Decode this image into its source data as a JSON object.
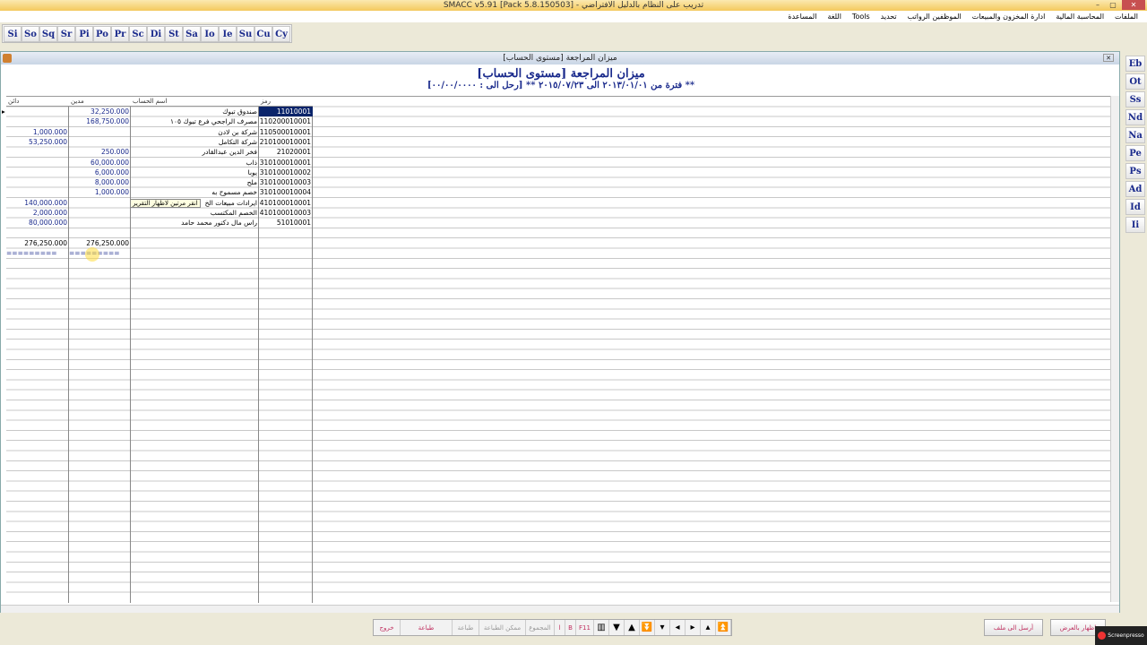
{
  "app": {
    "title": "SMACC v5.91 [Pack 5.8.150503]  -  تدريب على النظام بالدليل الافتراضي"
  },
  "menu": [
    "الملفات",
    "المحاسبة المالية",
    "ادارة المخزون والمبيعات",
    "الموظفين الرواتب",
    "تحديد",
    "Tools",
    "اللغة",
    "المساعدة"
  ],
  "toolbar": [
    "Si",
    "So",
    "Sq",
    "Sr",
    "Pi",
    "Po",
    "Pr",
    "Sc",
    "Di",
    "St",
    "Sa",
    "Io",
    "Ie",
    "Su",
    "Cu",
    "Cy"
  ],
  "rightbar": [
    "Eb",
    "Ot",
    "Ss",
    "Nd",
    "Na",
    "Pe",
    "Ps",
    "Ad",
    "Id",
    "Ii"
  ],
  "report": {
    "window_title": "ميزان المراجعة [مستوى الحساب]",
    "title": "ميزان المراجعة [مستوى الحساب]",
    "subtitle": "فترة من ٢٠١٣/٠١/٠١ الى ٢٠١٥/٠٧/٢٣ ** [رحل الى : ٠٠/٠٠/٠٠٠٠] **",
    "headers": {
      "code": "رمز",
      "name": "اسم الحساب",
      "debit": "مدين",
      "credit": "دائن"
    },
    "rows": [
      {
        "code": "11010001",
        "name": "صندوق تبوك",
        "debit": "32,250.000",
        "credit": ""
      },
      {
        "code": "110200010001",
        "name": "مصرف الراجحي فرع تبوك ١٠٥",
        "debit": "168,750.000",
        "credit": ""
      },
      {
        "code": "110500010001",
        "name": "شركة بن لادن",
        "debit": "",
        "credit": "1,000.000"
      },
      {
        "code": "210100010001",
        "name": "شركة التكامل",
        "debit": "",
        "credit": "53,250.000"
      },
      {
        "code": "21020001",
        "name": "فخر الدين عبدالقادر",
        "debit": "250.000",
        "credit": ""
      },
      {
        "code": "310100010001",
        "name": "ذاب",
        "debit": "60,000.000",
        "credit": ""
      },
      {
        "code": "310100010002",
        "name": "يوبا",
        "debit": "6,000.000",
        "credit": ""
      },
      {
        "code": "310100010003",
        "name": "ملح",
        "debit": "8,000.000",
        "credit": ""
      },
      {
        "code": "310100010004",
        "name": "خصم مسموح به",
        "debit": "1,000.000",
        "credit": ""
      },
      {
        "code": "410100010001",
        "name": "ايرادات مبيعات الخ",
        "debit": "",
        "credit": "140,000.000"
      },
      {
        "code": "410100010003",
        "name": "الخصم المكتسب",
        "debit": "",
        "credit": "2,000.000"
      },
      {
        "code": "51010001",
        "name": "راس مال دكتور محمد حامد",
        "debit": "",
        "credit": "80,000.000"
      }
    ],
    "total_debit": "276,250.000",
    "total_credit": "276,250.000",
    "separator": "=========",
    "tooltip": "انقر مرتين لاظهار التقرير"
  },
  "bottom": {
    "exit": "خروج",
    "print": "طباعة",
    "print2": "طباعة",
    "print_settings": "ممكن الطباعة",
    "total": "المجموع",
    "l": "ا",
    "b": "B",
    "f11": "F11",
    "send_file": "أرسل الى ملف",
    "show_display": "اظهار بالعرض"
  }
}
